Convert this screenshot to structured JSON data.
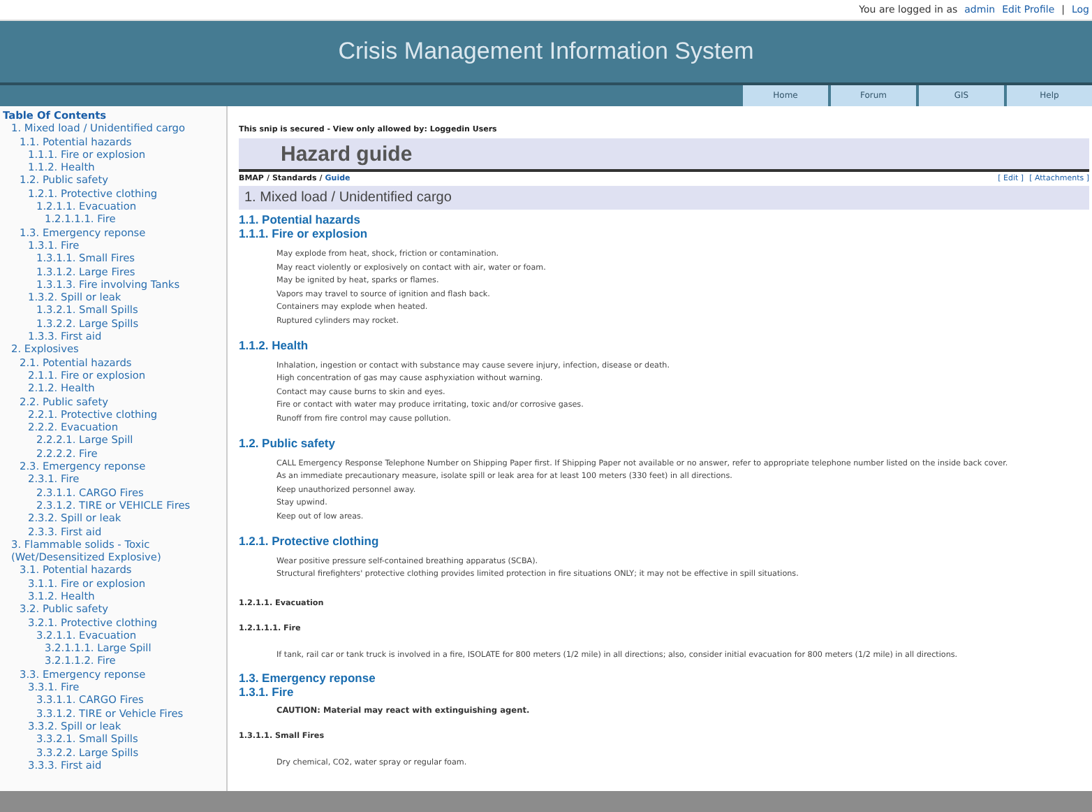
{
  "top_bar": {
    "prefix": "You are logged in as",
    "user": "admin",
    "links": [
      "Edit Profile",
      "Log"
    ],
    "separator": "|"
  },
  "header": {
    "title": "Crisis Management Information System"
  },
  "nav": [
    {
      "label": "Home"
    },
    {
      "label": "Forum"
    },
    {
      "label": "GIS"
    },
    {
      "label": "Help"
    }
  ],
  "toc": {
    "title": "Table Of Contents",
    "items": [
      {
        "label": "1. Mixed load / Unidentified cargo",
        "children": [
          {
            "label": "1.1. Potential hazards",
            "children": [
              {
                "label": "1.1.1. Fire or explosion"
              },
              {
                "label": "1.1.2. Health"
              }
            ]
          },
          {
            "label": "1.2. Public safety",
            "children": [
              {
                "label": "1.2.1. Protective clothing",
                "children": [
                  {
                    "label": "1.2.1.1. Evacuation",
                    "children": [
                      {
                        "label": "1.2.1.1.1. Fire"
                      }
                    ]
                  }
                ]
              }
            ]
          },
          {
            "label": "1.3. Emergency reponse",
            "children": [
              {
                "label": "1.3.1. Fire",
                "children": [
                  {
                    "label": "1.3.1.1. Small Fires"
                  },
                  {
                    "label": "1.3.1.2. Large Fires"
                  },
                  {
                    "label": "1.3.1.3. Fire involving Tanks"
                  }
                ]
              },
              {
                "label": "1.3.2. Spill or leak",
                "children": [
                  {
                    "label": "1.3.2.1. Small Spills"
                  },
                  {
                    "label": "1.3.2.2. Large Spills"
                  }
                ]
              },
              {
                "label": "1.3.3. First aid"
              }
            ]
          }
        ]
      },
      {
        "label": "2. Explosives",
        "children": [
          {
            "label": "2.1. Potential hazards",
            "children": [
              {
                "label": "2.1.1. Fire or explosion"
              },
              {
                "label": "2.1.2. Health"
              }
            ]
          },
          {
            "label": "2.2. Public safety",
            "children": [
              {
                "label": "2.2.1. Protective clothing"
              },
              {
                "label": "2.2.2. Evacuation",
                "children": [
                  {
                    "label": "2.2.2.1. Large Spill"
                  },
                  {
                    "label": "2.2.2.2. Fire"
                  }
                ]
              }
            ]
          },
          {
            "label": "2.3. Emergency reponse",
            "children": [
              {
                "label": "2.3.1. Fire",
                "children": [
                  {
                    "label": "2.3.1.1. CARGO Fires"
                  },
                  {
                    "label": "2.3.1.2. TIRE or VEHICLE Fires"
                  }
                ]
              },
              {
                "label": "2.3.2. Spill or leak"
              },
              {
                "label": "2.3.3. First aid"
              }
            ]
          }
        ]
      },
      {
        "label": "3. Flammable solids - Toxic (Wet/Desensitized Explosive)",
        "children": [
          {
            "label": "3.1. Potential hazards",
            "children": [
              {
                "label": "3.1.1. Fire or explosion"
              },
              {
                "label": "3.1.2. Health"
              }
            ]
          },
          {
            "label": "3.2. Public safety",
            "children": [
              {
                "label": "3.2.1. Protective clothing",
                "children": [
                  {
                    "label": "3.2.1.1. Evacuation",
                    "children": [
                      {
                        "label": "3.2.1.1.1. Large Spill"
                      },
                      {
                        "label": "3.2.1.1.2. Fire"
                      }
                    ]
                  }
                ]
              }
            ]
          },
          {
            "label": "3.3. Emergency reponse",
            "children": [
              {
                "label": "3.3.1. Fire",
                "children": [
                  {
                    "label": "3.3.1.1. CARGO Fires"
                  },
                  {
                    "label": "3.3.1.2. TIRE or Vehicle Fires"
                  }
                ]
              },
              {
                "label": "3.3.2. Spill or leak",
                "children": [
                  {
                    "label": "3.3.2.1. Small Spills"
                  },
                  {
                    "label": "3.3.2.2. Large Spills"
                  }
                ]
              },
              {
                "label": "3.3.3. First aid"
              }
            ]
          }
        ]
      }
    ]
  },
  "page": {
    "notice": "This snip is secured - View only allowed by: Loggedin Users",
    "title": "Hazard guide",
    "breadcrumb": [
      {
        "label": "BMAP",
        "current": false
      },
      {
        "label": "Standards",
        "current": false
      },
      {
        "label": "Guide",
        "current": true
      }
    ],
    "breadcrumb_separator": "/",
    "actions": [
      "[ Edit ]",
      "[ Attachments ]"
    ],
    "heading": "1. Mixed load / Unidentified cargo",
    "blocks": [
      {
        "kind": "section",
        "text": "1.1. Potential hazards"
      },
      {
        "kind": "section",
        "text": "1.1.1. Fire or explosion"
      },
      {
        "kind": "text",
        "lines": [
          "May explode from heat, shock, friction or contamination.",
          "May react violently or explosively on contact with air, water or foam.",
          "May be ignited by heat, sparks or flames.",
          "Vapors may travel to source of ignition and flash back.",
          "Containers may explode when heated.",
          "Ruptured cylinders may rocket."
        ]
      },
      {
        "kind": "section",
        "text": "1.1.2. Health"
      },
      {
        "kind": "text",
        "lines": [
          "Inhalation, ingestion or contact with substance may cause severe injury, infection, disease or death.",
          "High concentration of gas may cause asphyxiation without warning.",
          "Contact may cause burns to skin and eyes.",
          "Fire or contact with water may produce irritating, toxic and/or corrosive gases.",
          "Runoff from fire control may cause pollution."
        ]
      },
      {
        "kind": "section",
        "text": "1.2. Public safety"
      },
      {
        "kind": "text",
        "lines": [
          "CALL Emergency Response Telephone Number on Shipping Paper first. If Shipping Paper not available or no answer, refer to appropriate telephone number listed on the inside back cover.",
          "As an immediate precautionary measure, isolate spill or leak area for at least 100 meters (330 feet) in all directions.",
          "Keep unauthorized personnel away.",
          "Stay upwind.",
          "Keep out of low areas."
        ]
      },
      {
        "kind": "section",
        "text": "1.2.1. Protective clothing"
      },
      {
        "kind": "text",
        "lines": [
          "Wear positive pressure self-contained breathing apparatus (SCBA).",
          "Structural firefighters' protective clothing provides limited protection in fire situations ONLY; it may not be effective in spill situations."
        ]
      },
      {
        "kind": "minor",
        "text": "1.2.1.1. Evacuation"
      },
      {
        "kind": "minor",
        "text": "1.2.1.1.1. Fire"
      },
      {
        "kind": "text",
        "lines": [
          "If tank, rail car or tank truck is involved in a fire, ISOLATE for 800 meters (1/2 mile) in all directions; also, consider initial evacuation for 800 meters (1/2 mile) in all directions."
        ]
      },
      {
        "kind": "section",
        "text": "1.3. Emergency reponse"
      },
      {
        "kind": "section",
        "text": "1.3.1. Fire"
      },
      {
        "kind": "note",
        "text": "CAUTION: Material may react with extinguishing agent."
      },
      {
        "kind": "minor",
        "text": "1.3.1.1. Small Fires"
      },
      {
        "kind": "text",
        "lines": [
          "Dry chemical, CO2, water spray or regular foam."
        ]
      }
    ]
  }
}
